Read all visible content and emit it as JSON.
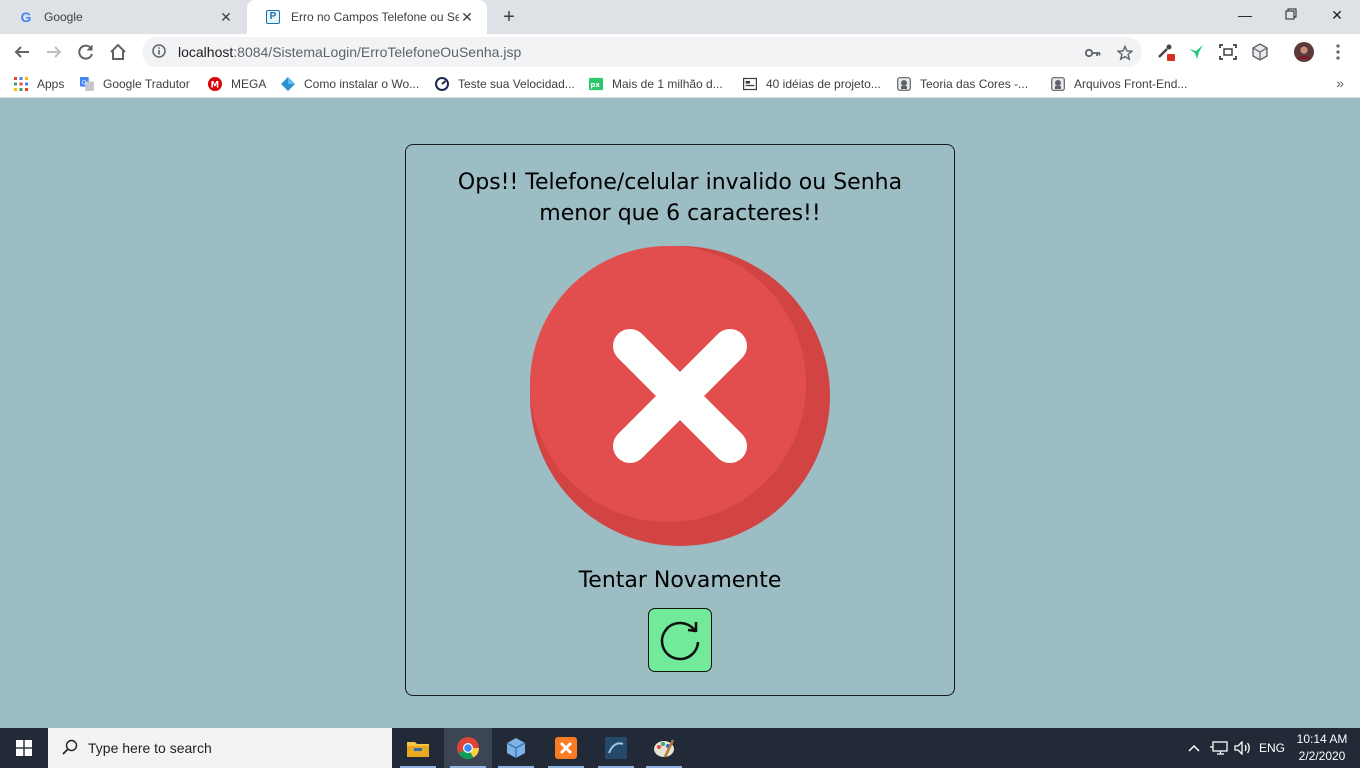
{
  "browser": {
    "tabs": [
      {
        "title": "Google",
        "active": false,
        "favicon": "google-g-icon"
      },
      {
        "title": "Erro no Campos Telefone ou Senha",
        "active": true,
        "favicon": "p-favicon-icon"
      }
    ],
    "url_host": "localhost",
    "url_path": ":8084/SistemaLogin/ErroTelefoneOuSenha.jsp",
    "bookmarks": [
      {
        "label": "Apps",
        "icon": "apps-grid-icon"
      },
      {
        "label": "Google Tradutor",
        "icon": "translate-icon"
      },
      {
        "label": "MEGA",
        "icon": "mega-icon"
      },
      {
        "label": "Como instalar o Wo...",
        "icon": "diamond-icon"
      },
      {
        "label": "Teste sua Velocidad...",
        "icon": "speedtest-icon"
      },
      {
        "label": "Mais de 1 milhão d...",
        "icon": "pixabay-icon"
      },
      {
        "label": "40 idéias de projeto...",
        "icon": "image-icon"
      },
      {
        "label": "Teoria das Cores -...",
        "icon": "site-icon"
      },
      {
        "label": "Arquivos Front-End...",
        "icon": "site-icon"
      }
    ]
  },
  "content": {
    "error_message": "Ops!! Telefone/celular invalido ou Senha menor que 6 caracteres!!",
    "retry_label": "Tentar Novamente",
    "colors": {
      "background": "#9dbdc5",
      "error_red": "#e24e4e",
      "retry_green": "#73e99a"
    }
  },
  "taskbar": {
    "search_placeholder": "Type here to search",
    "language": "ENG",
    "time": "10:14 AM",
    "date": "2/2/2020"
  }
}
